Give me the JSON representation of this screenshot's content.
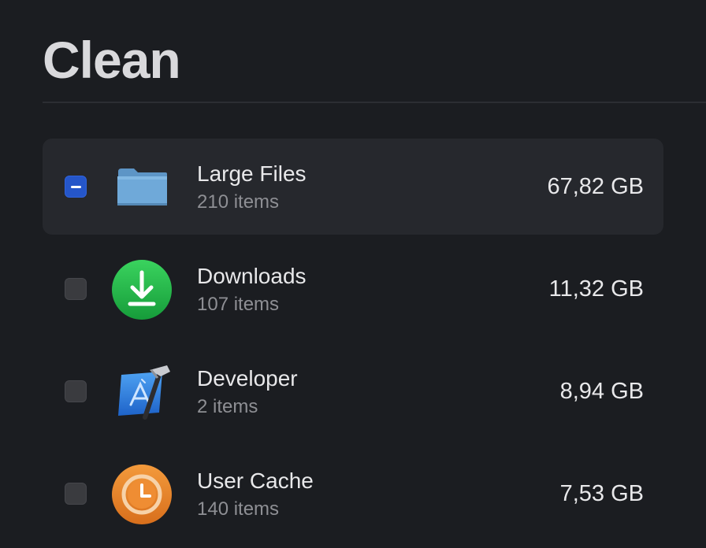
{
  "page": {
    "title": "Clean"
  },
  "items": [
    {
      "label": "Large Files",
      "count": "210 items",
      "size": "67,82 GB",
      "state": "mixed",
      "icon": "folder-icon"
    },
    {
      "label": "Downloads",
      "count": "107 items",
      "size": "11,32 GB",
      "state": "unchecked",
      "icon": "download-icon"
    },
    {
      "label": "Developer",
      "count": "2 items",
      "size": "8,94 GB",
      "state": "unchecked",
      "icon": "xcode-icon"
    },
    {
      "label": "User Cache",
      "count": "140 items",
      "size": "7,53 GB",
      "state": "unchecked",
      "icon": "clock-icon"
    }
  ],
  "colors": {
    "background": "#1b1d21",
    "selected_row": "#26282d",
    "checkbox_active": "#2556c9",
    "download_green": "#22b94a",
    "cache_orange": "#e8862a",
    "xcode_blue": "#2f7de1",
    "folder_blue": "#6aa6d6"
  }
}
